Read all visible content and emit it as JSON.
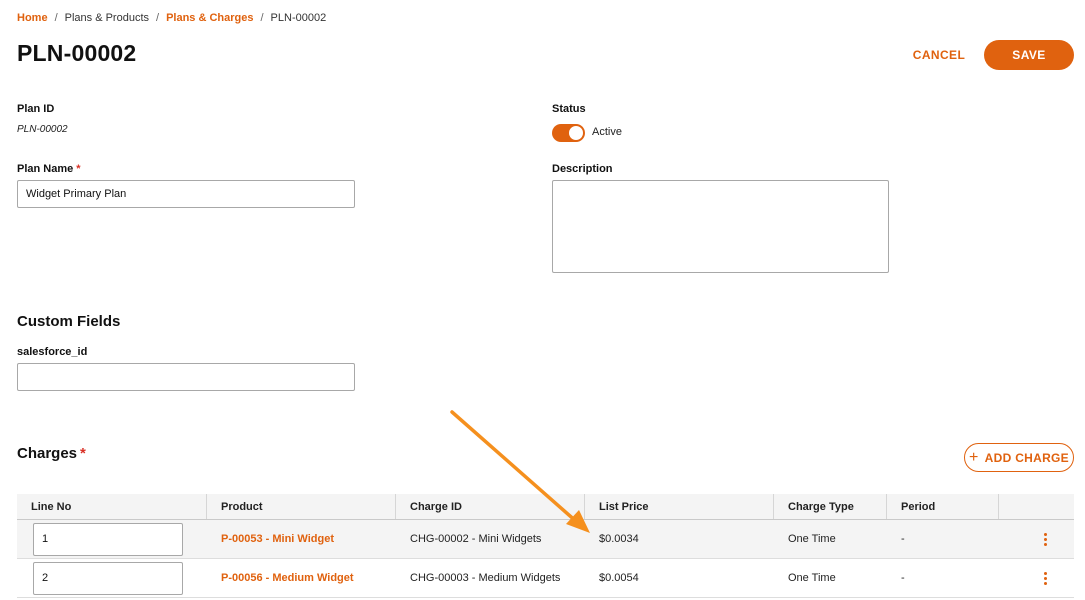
{
  "breadcrumb": {
    "home": "Home",
    "plans_products": "Plans & Products",
    "plans_charges": "Plans & Charges",
    "current": "PLN-00002",
    "separator": "/"
  },
  "header": {
    "title": "PLN-00002",
    "cancel_label": "CANCEL",
    "save_label": "SAVE"
  },
  "form": {
    "plan_id_label": "Plan ID",
    "plan_id_value": "PLN-00002",
    "plan_name_label": "Plan Name",
    "plan_name_value": "Widget Primary Plan",
    "required_mark": "*",
    "status_label": "Status",
    "status_value": "Active",
    "status_on": true,
    "description_label": "Description",
    "description_value": ""
  },
  "custom_fields": {
    "title": "Custom Fields",
    "salesforce_label": "salesforce_id",
    "salesforce_value": ""
  },
  "charges": {
    "title": "Charges",
    "add_label": "ADD CHARGE",
    "columns": [
      "Line No",
      "Product",
      "Charge ID",
      "List Price",
      "Charge Type",
      "Period",
      ""
    ],
    "rows": [
      {
        "line": "1",
        "product": "P-00053 - Mini Widget",
        "charge_id": "CHG-00002 - Mini Widgets",
        "price": "$0.0034",
        "type": "One Time",
        "period": "-"
      },
      {
        "line": "2",
        "product": "P-00056 - Medium Widget",
        "charge_id": "CHG-00003 - Medium Widgets",
        "price": "$0.0054",
        "type": "One Time",
        "period": "-"
      }
    ]
  },
  "colors": {
    "accent": "#e0620f",
    "annotation_arrow": "#f5901e",
    "required": "#d93025"
  },
  "icons": {
    "add": "plus-icon",
    "row_menu": "kebab-menu-icon",
    "annotation": "arrow-annotation-icon"
  }
}
